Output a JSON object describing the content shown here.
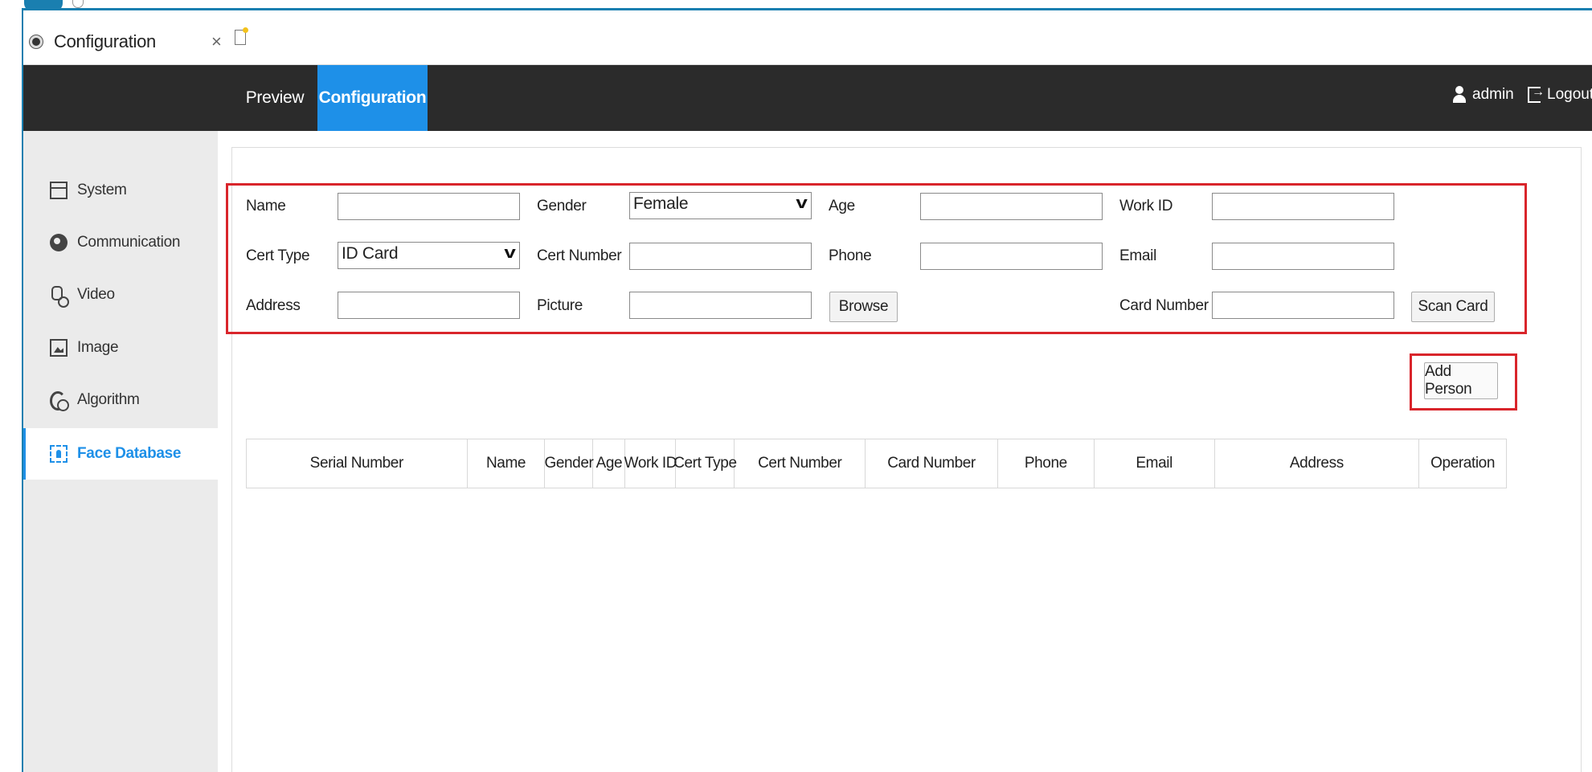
{
  "browser": {
    "tab_title": "Configuration",
    "tab_close": "×"
  },
  "header": {
    "nav": {
      "preview": "Preview",
      "configuration": "Configuration"
    },
    "user": "admin",
    "logout": "Logout",
    "colors": {
      "bar": "#2b2b2b",
      "active": "#1e90e8"
    }
  },
  "sidebar": {
    "items": [
      {
        "label": "System",
        "icon": "system-icon"
      },
      {
        "label": "Communication",
        "icon": "communication-icon"
      },
      {
        "label": "Video",
        "icon": "video-icon"
      },
      {
        "label": "Image",
        "icon": "image-icon"
      },
      {
        "label": "Algorithm",
        "icon": "algorithm-icon"
      },
      {
        "label": "Face Database",
        "icon": "face-database-icon",
        "active": true
      }
    ]
  },
  "form": {
    "name": {
      "label": "Name",
      "value": ""
    },
    "gender": {
      "label": "Gender",
      "value": "Female"
    },
    "age": {
      "label": "Age",
      "value": ""
    },
    "work_id": {
      "label": "Work ID",
      "value": ""
    },
    "cert_type": {
      "label": "Cert Type",
      "value": "ID Card"
    },
    "cert_number": {
      "label": "Cert Number",
      "value": ""
    },
    "phone": {
      "label": "Phone",
      "value": ""
    },
    "email": {
      "label": "Email",
      "value": ""
    },
    "address": {
      "label": "Address",
      "value": ""
    },
    "picture": {
      "label": "Picture",
      "value": ""
    },
    "browse_button": "Browse",
    "card_number": {
      "label": "Card Number",
      "value": ""
    },
    "scan_card_button": "Scan Card"
  },
  "add_person_button": "Add Person",
  "table": {
    "columns": [
      "Serial Number",
      "Name",
      "Gender",
      "Age",
      "Work ID",
      "Cert Type",
      "Cert Number",
      "Card Number",
      "Phone",
      "Email",
      "Address",
      "Operation"
    ],
    "rows": []
  },
  "highlight_color": "#d9252b"
}
